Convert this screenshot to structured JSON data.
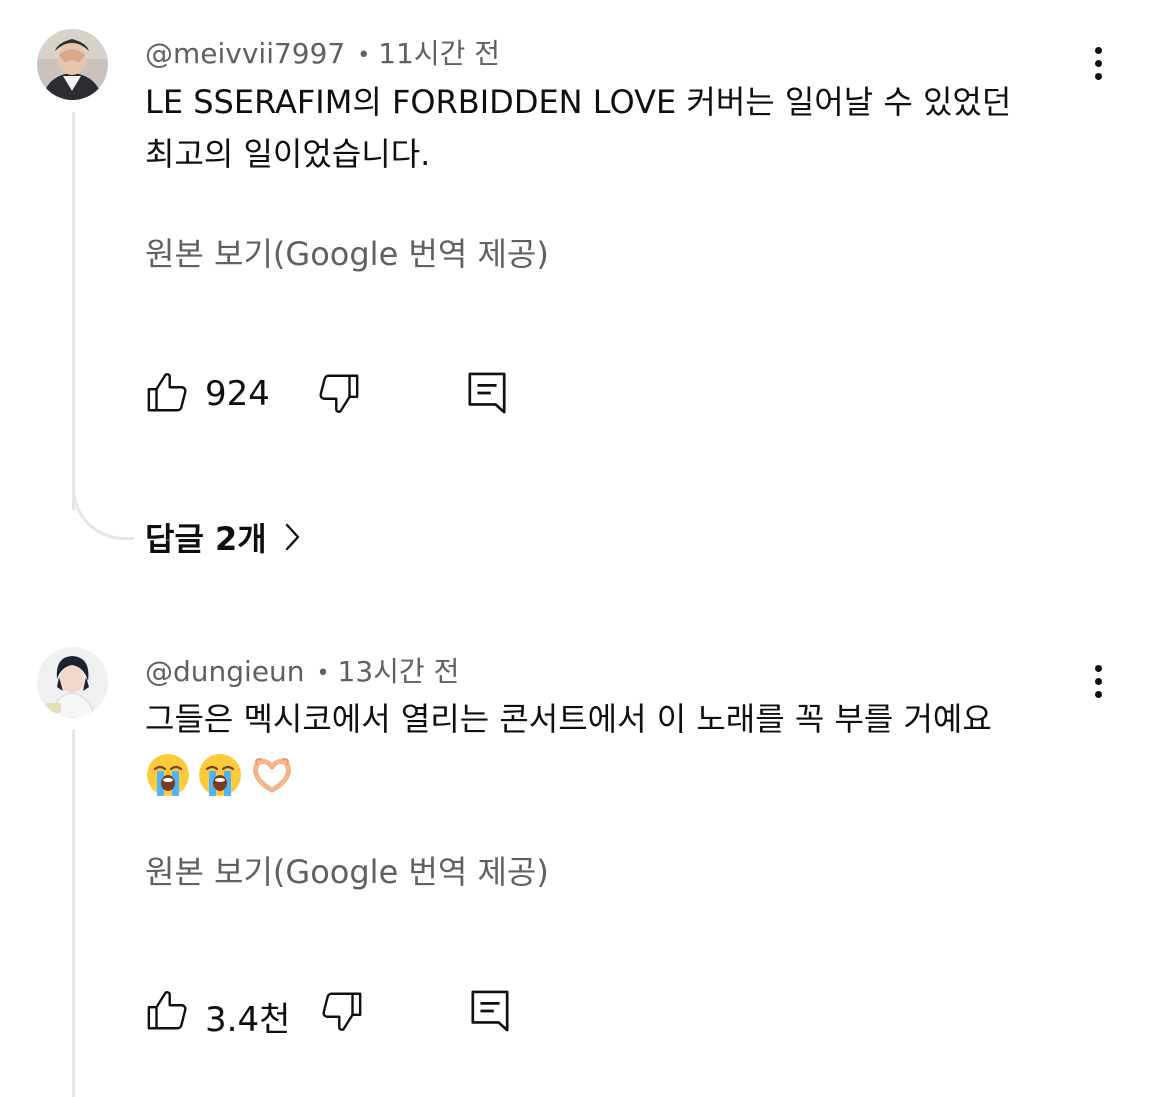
{
  "comments": [
    {
      "handle": "@meivvii7997",
      "time": "11시간 전",
      "text_lines": [
        "LE SSERAFIM의 FORBIDDEN LOVE 커버는 일어날 수 있었던",
        "최고의 일이었습니다."
      ],
      "translate_label": "원본 보기(Google 번역 제공)",
      "likes": "924",
      "replies_label": "답글 2개"
    },
    {
      "handle": "@dungieun",
      "time": "13시간 전",
      "text_lines": [
        "그들은 멕시코에서 열리는 콘서트에서 이 노래를 꼭 부를 거예요"
      ],
      "emojis": [
        "loudly-crying-face",
        "loudly-crying-face",
        "heart-hands"
      ],
      "translate_label": "원본 보기(Google 번역 제공)",
      "likes": "3.4천"
    }
  ],
  "colors": {
    "text": "#0f0f0f",
    "secondary": "#606060",
    "thread_line": "#e5e5e5"
  }
}
